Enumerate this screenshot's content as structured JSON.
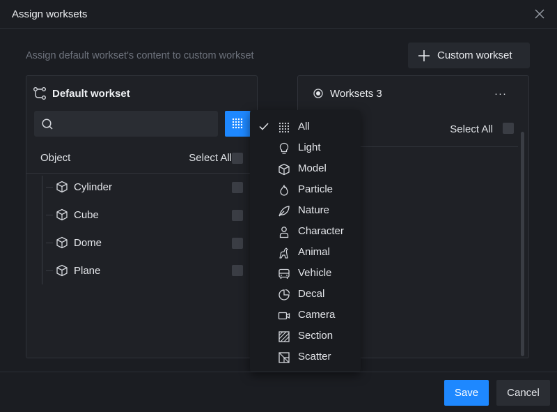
{
  "dialog": {
    "title": "Assign worksets",
    "subtitle": "Assign default workset's content to custom workset",
    "custom_workset_label": "Custom workset"
  },
  "left_panel": {
    "title": "Default workset",
    "search_placeholder": "",
    "column_object": "Object",
    "select_all": "Select All",
    "items": [
      {
        "name": "Cylinder",
        "icon": "cube-icon"
      },
      {
        "name": "Cube",
        "icon": "cube-icon"
      },
      {
        "name": "Dome",
        "icon": "cube-icon"
      },
      {
        "name": "Plane",
        "icon": "cube-icon"
      }
    ]
  },
  "right_panel": {
    "title": "Worksets 3",
    "more_label": "···",
    "select_all": "Select All"
  },
  "filter_menu": {
    "selected": "All",
    "items": [
      {
        "label": "All",
        "icon": "grid-icon",
        "checked": true
      },
      {
        "label": "Light",
        "icon": "bulb-icon",
        "checked": false
      },
      {
        "label": "Model",
        "icon": "cube-icon",
        "checked": false
      },
      {
        "label": "Particle",
        "icon": "flame-icon",
        "checked": false
      },
      {
        "label": "Nature",
        "icon": "leaf-icon",
        "checked": false
      },
      {
        "label": "Character",
        "icon": "person-icon",
        "checked": false
      },
      {
        "label": "Animal",
        "icon": "animal-icon",
        "checked": false
      },
      {
        "label": "Vehicle",
        "icon": "bus-icon",
        "checked": false
      },
      {
        "label": "Decal",
        "icon": "decal-icon",
        "checked": false
      },
      {
        "label": "Camera",
        "icon": "camera-icon",
        "checked": false
      },
      {
        "label": "Section",
        "icon": "section-icon",
        "checked": false
      },
      {
        "label": "Scatter",
        "icon": "scatter-icon",
        "checked": false
      }
    ]
  },
  "footer": {
    "save_label": "Save",
    "cancel_label": "Cancel"
  },
  "colors": {
    "accent": "#1e88ff",
    "background": "#1b1d22",
    "panel": "#1f2126"
  }
}
